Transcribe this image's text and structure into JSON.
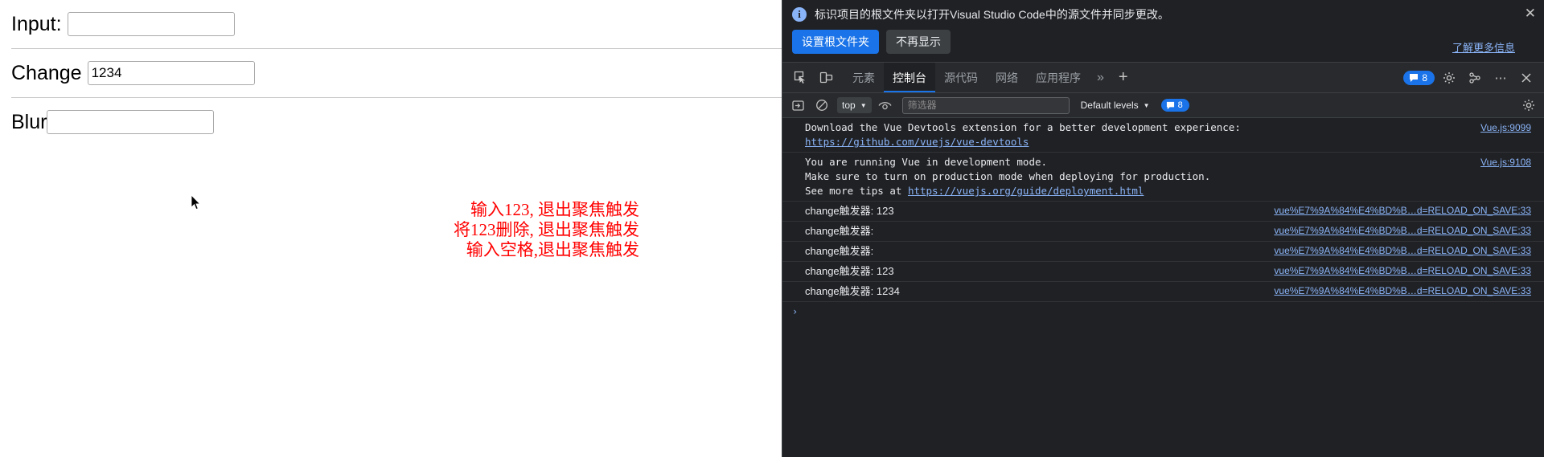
{
  "page": {
    "rows": [
      {
        "label": "Input:",
        "value": "",
        "placeholder": ""
      },
      {
        "label": "Change",
        "value": "1234",
        "placeholder": ""
      },
      {
        "label": "Blur",
        "value": "",
        "placeholder": ""
      }
    ],
    "annotations": [
      "输入123, 退出聚焦触发",
      "将123删除, 退出聚焦触发",
      "输入空格,退出聚焦触发"
    ],
    "annotation_color": "#ff0000"
  },
  "devtools": {
    "notification": {
      "icon": "info-icon",
      "text": "标识项目的根文件夹以打开Visual Studio Code中的源文件并同步更改。",
      "primary_button": "设置根文件夹",
      "secondary_button": "不再显示",
      "link": "了解更多信息",
      "close": "✕"
    },
    "tabbar": {
      "inspect_icon": "inspect-element-icon",
      "device_icon": "device-toolbar-icon",
      "tabs": [
        {
          "label": "元素",
          "active": false
        },
        {
          "label": "控制台",
          "active": true
        },
        {
          "label": "源代码",
          "active": false
        },
        {
          "label": "网络",
          "active": false
        },
        {
          "label": "应用程序",
          "active": false
        }
      ],
      "more": "»",
      "plus": "+",
      "message_count": "8",
      "settings_icon": "gear-icon",
      "customize_icon": "customize-icon",
      "dots_icon": "more-options-icon",
      "close_icon": "close-icon"
    },
    "console_toolbar": {
      "sidebar_icon": "console-sidebar-icon",
      "clear_icon": "clear-console-icon",
      "context": "top",
      "eye_icon": "live-expression-icon",
      "filter_placeholder": "筛选器",
      "filter_value": "",
      "levels": "Default levels",
      "issues_count": "8",
      "settings_icon": "console-settings-icon"
    },
    "console_logs": [
      {
        "type": "group",
        "lines": [
          {
            "text": "Download the Vue Devtools extension for a better development experience:",
            "link": false
          },
          {
            "text": "https://github.com/vuejs/vue-devtools",
            "link": true
          }
        ],
        "source": "Vue.js:9099"
      },
      {
        "type": "group",
        "lines": [
          {
            "text": "You are running Vue in development mode.",
            "link": false
          },
          {
            "text": "Make sure to turn on production mode when deploying for production.",
            "link": false
          },
          {
            "text": "See more tips at ",
            "link": false,
            "suffix_link": "https://vuejs.org/guide/deployment.html"
          }
        ],
        "source": "Vue.js:9108"
      },
      {
        "type": "row",
        "text": "change触发器: 123",
        "source": "vue%E7%9A%84%E4%BD%B…d=RELOAD_ON_SAVE:33"
      },
      {
        "type": "row",
        "text": "change触发器: ",
        "source": "vue%E7%9A%84%E4%BD%B…d=RELOAD_ON_SAVE:33"
      },
      {
        "type": "row",
        "text": "change触发器: ",
        "source": "vue%E7%9A%84%E4%BD%B…d=RELOAD_ON_SAVE:33"
      },
      {
        "type": "row",
        "text": "change触发器: 123",
        "source": "vue%E7%9A%84%E4%BD%B…d=RELOAD_ON_SAVE:33"
      },
      {
        "type": "row",
        "text": "change触发器: 1234",
        "source": "vue%E7%9A%84%E4%BD%B…d=RELOAD_ON_SAVE:33"
      }
    ],
    "prompt": "›",
    "colors": {
      "accent": "#1a73e8",
      "link": "#8ab4f8",
      "background": "#202124",
      "toolbar": "#292a2d"
    }
  }
}
